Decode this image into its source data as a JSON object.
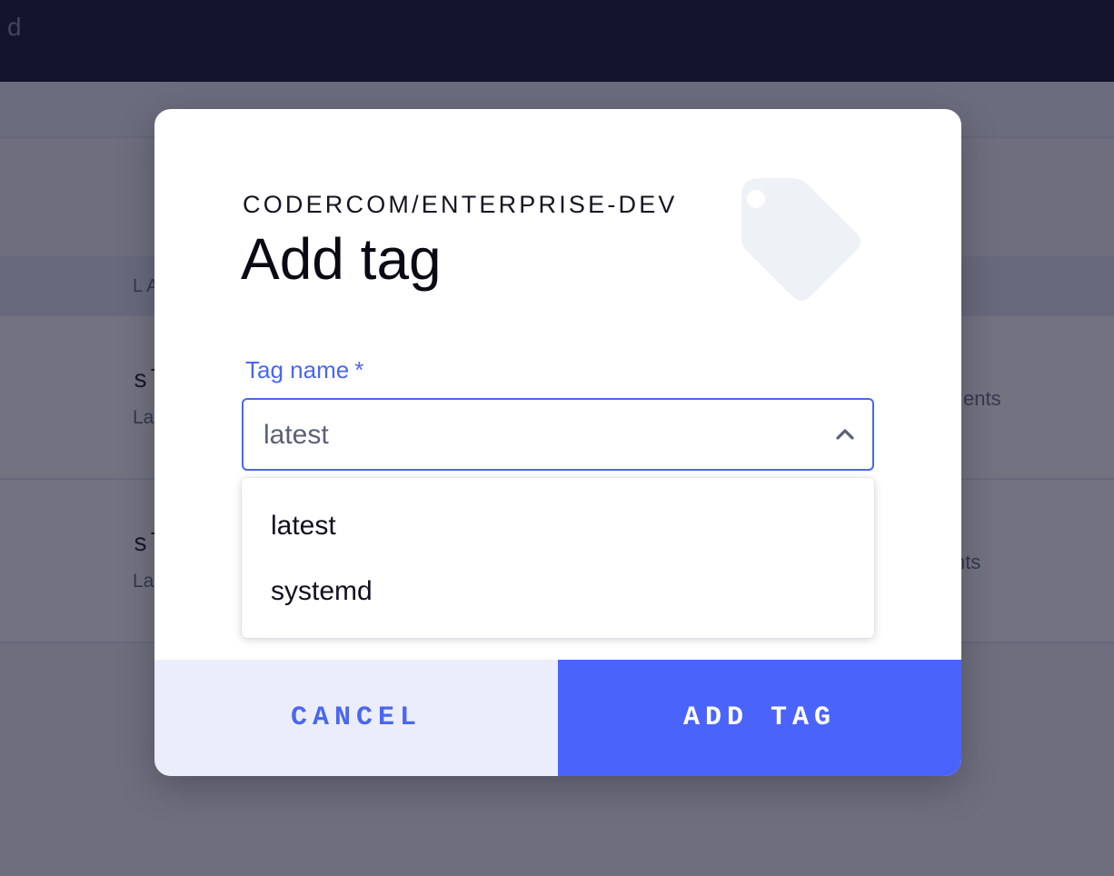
{
  "background": {
    "topbar_text": "d",
    "table_header": "LA",
    "rows": [
      {
        "name": "sl",
        "sub": "La",
        "right": "ents"
      },
      {
        "name": "sl",
        "sub": "La",
        "right": "nts"
      }
    ]
  },
  "modal": {
    "subtitle": "CODERCOM/ENTERPRISE-DEV",
    "title": "Add tag",
    "decor_icon": "tag-icon",
    "field": {
      "label": "Tag name",
      "required_marker": "*",
      "value": "latest",
      "expanded": true,
      "toggle_icon": "chevron-up-icon",
      "options": [
        "latest",
        "systemd"
      ]
    },
    "buttons": {
      "cancel": "CANCEL",
      "submit": "ADD TAG"
    }
  },
  "colors": {
    "accent": "#4a67f0",
    "primary_button": "#4a64fb",
    "cancel_button_bg": "#ecedfb",
    "topbar": "#161632",
    "icon_fill": "#eef1f6"
  }
}
